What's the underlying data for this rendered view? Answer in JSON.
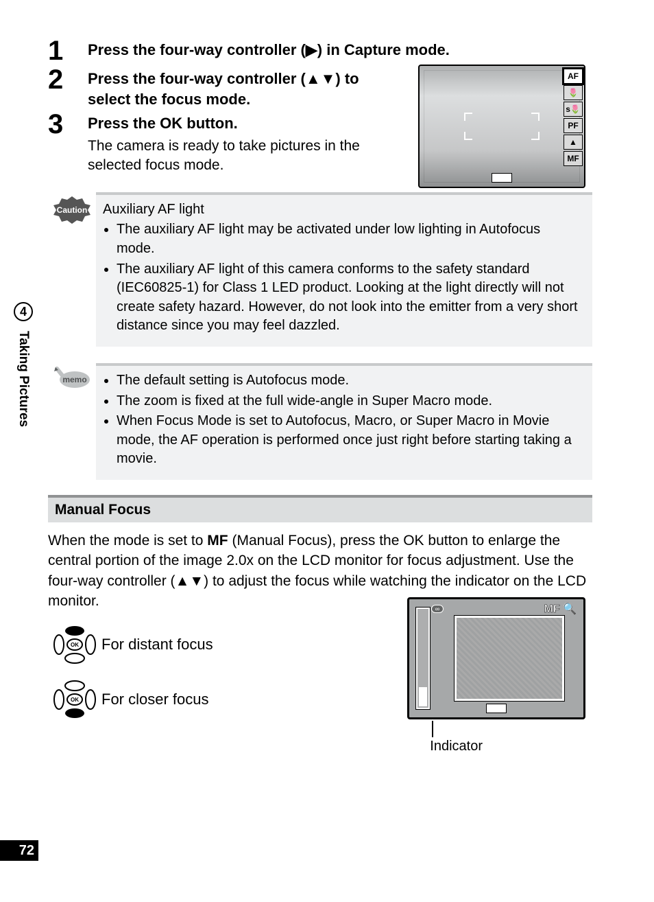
{
  "chapter": {
    "number": "4",
    "title": "Taking Pictures"
  },
  "page_number": "72",
  "steps": [
    {
      "num": "1",
      "title_parts": [
        "Press the four-way controller (",
        "▶",
        ") in Capture mode."
      ]
    },
    {
      "num": "2",
      "title_parts": [
        "Press the four-way controller (",
        "▲▼",
        ") to select the focus mode."
      ]
    },
    {
      "num": "3",
      "title_parts": [
        "Press the OK button."
      ],
      "desc": "The camera is ready to take pictures in the selected focus mode."
    }
  ],
  "caution": {
    "label": "Caution",
    "subtitle": "Auxiliary AF light",
    "bullets": [
      "The auxiliary AF light may be activated under low lighting in Autofocus mode.",
      "The auxiliary AF light of this camera conforms to the safety standard (IEC60825-1) for Class 1 LED product. Looking at the light directly will not create safety hazard. However, do not look into the emitter from a very short distance since you may feel dazzled."
    ]
  },
  "memo": {
    "label": "memo",
    "bullets": [
      "The default setting is Autofocus mode.",
      "The zoom is fixed at the full wide-angle in Super Macro mode.",
      "When Focus Mode is set to Autofocus, Macro, or Super Macro in Movie mode, the AF operation is performed once just right before starting taking a movie."
    ]
  },
  "section": {
    "header": "Manual Focus",
    "para_before_symbol": "When the mode is set to ",
    "mf_symbol": "MF",
    "para_after_symbol": " (Manual Focus), press the OK button to enlarge the central portion of the image 2.0x on the LCD monitor for focus adjustment. Use the four-way controller (",
    "arrows": "▲▼",
    "para_end": ") to adjust the focus while watching the indicator on the LCD monitor."
  },
  "focus_controls": {
    "up": "For distant focus",
    "down": "For closer focus"
  },
  "lcd1_modes": [
    "AF",
    "🌷",
    "s🌷",
    "PF",
    "▲",
    "MF"
  ],
  "lcd2": {
    "label": "MF",
    "magnify": "🔍",
    "infinity": "∞"
  },
  "indicator_label": "Indicator"
}
